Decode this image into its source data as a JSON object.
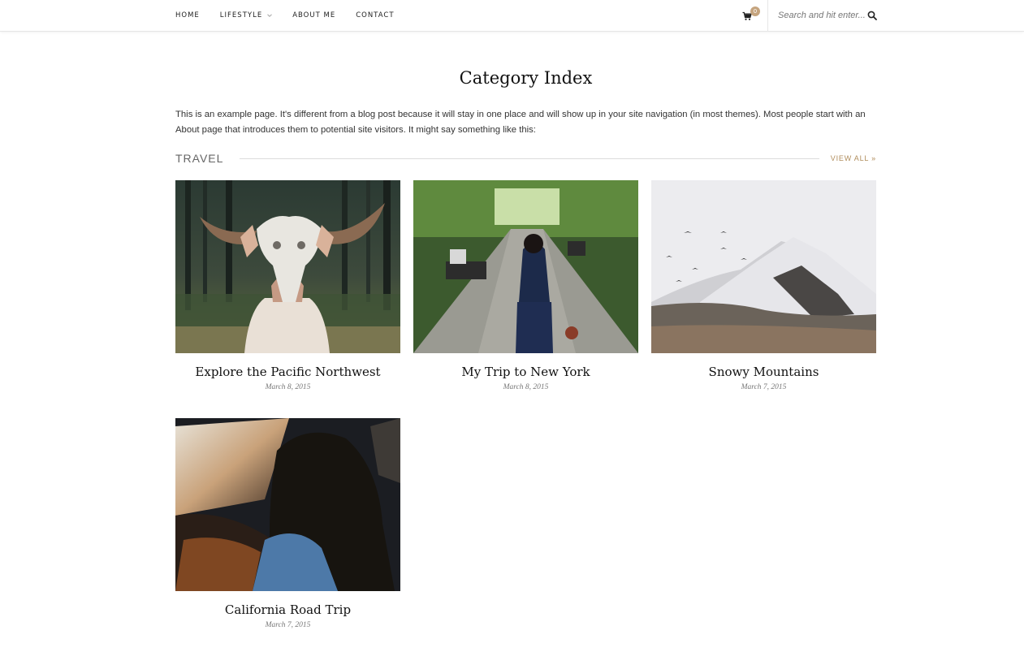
{
  "nav": {
    "items": [
      {
        "label": "HOME"
      },
      {
        "label": "LIFESTYLE"
      },
      {
        "label": "ABOUT ME"
      },
      {
        "label": "CONTACT"
      }
    ],
    "cart_count": "0",
    "search_placeholder": "Search and hit enter..."
  },
  "page": {
    "title": "Category Index",
    "intro": "This is an example page. It's different from a blog post because it will stay in one place and will show up in your site navigation (in most themes). Most people start with an About page that introduces them to potential site visitors. It might say something like this:"
  },
  "section": {
    "title": "TRAVEL",
    "view_all": "VIEW ALL »"
  },
  "posts": [
    {
      "title": "Explore the Pacific Northwest",
      "date": "March 8, 2015"
    },
    {
      "title": "My Trip to New York",
      "date": "March 8, 2015"
    },
    {
      "title": "Snowy Mountains",
      "date": "March 7, 2015"
    },
    {
      "title": "California Road Trip",
      "date": "March 7, 2015"
    }
  ],
  "colors": {
    "accent": "#c5a47e",
    "view_all": "#b08d5c"
  }
}
